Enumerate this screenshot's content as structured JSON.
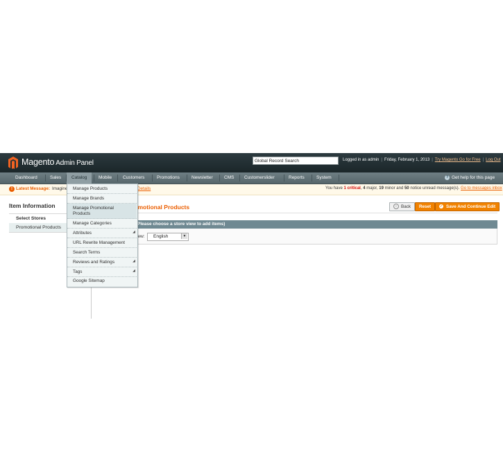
{
  "header": {
    "logo": "Magento",
    "logo_sub": "Admin Panel",
    "search_value": "Global Record Search",
    "logged_in": "Logged in as admin",
    "date": "Friday, February 1, 2013",
    "try_link": "Try Magento Go for Free",
    "logout": "Log Out"
  },
  "nav": {
    "items": [
      "Dashboard",
      "Sales",
      "Catalog",
      "Mobile",
      "Customers",
      "Promotions",
      "Newsletter",
      "CMS",
      "Customerslider",
      "Reports",
      "System"
    ],
    "help": "Get help for this page"
  },
  "notice": {
    "label": "Latest Message:",
    "text": "Imagine",
    "details_link": "Details",
    "right_prefix": "You have",
    "critical_count": "1",
    "critical_label": "critical",
    "major": "4",
    "major_label": "major,",
    "minor": "19",
    "minor_label": "minor and",
    "notice_count": "50",
    "notice_label": "notice unread message(s).",
    "inbox_link": "Go to messages inbox"
  },
  "side": {
    "title": "Item Information",
    "tabs": [
      "Select Stores",
      "Promotional Products"
    ]
  },
  "main": {
    "title": "romotional Products",
    "back": "Back",
    "reset": "Reset",
    "save": "Save And Continue Edit",
    "legend": "Please choose a store view to add items)",
    "store_label": "iew:",
    "store_value": "English"
  },
  "dropdown": {
    "items": [
      "Manage Products",
      "Manage Brands",
      "Manage Promotional",
      "Products",
      "Manage Categories",
      "Attributes",
      "URL Rewrite Management",
      "Search Terms",
      "Reviews and Ratings",
      "Tags",
      "Google Sitemap"
    ]
  },
  "colors": {
    "accent": "#eb5e00",
    "header": "#1f2b2f",
    "nav": "#5d6d72"
  }
}
